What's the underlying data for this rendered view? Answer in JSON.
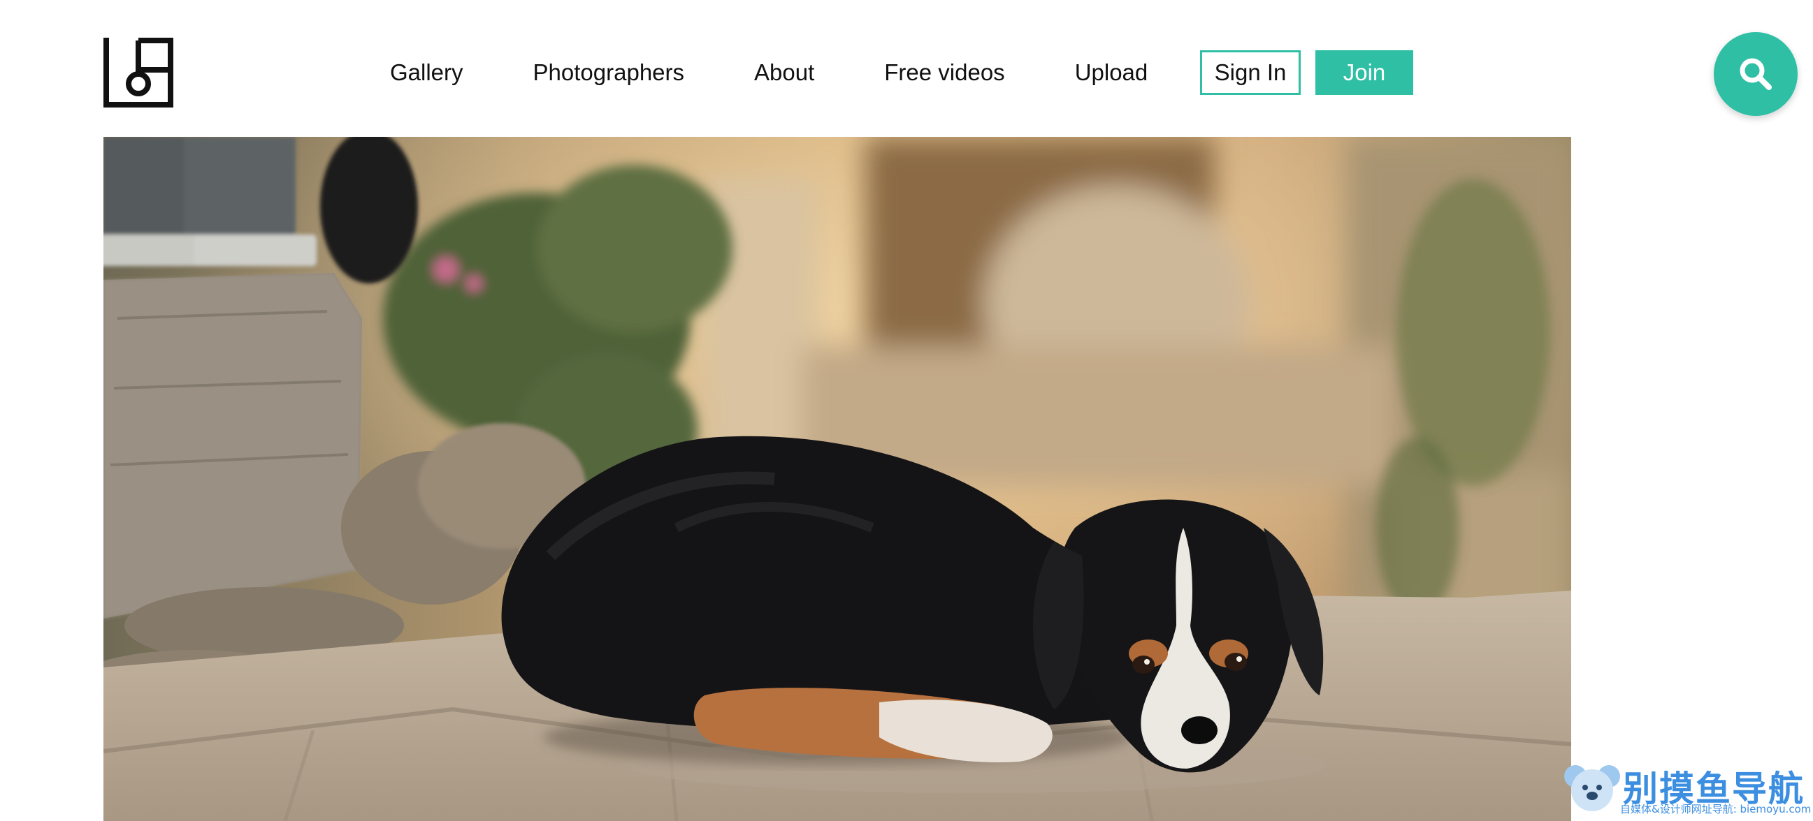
{
  "header": {
    "logo_icon": "camera-frame-logo-icon",
    "nav": [
      {
        "label": "Gallery"
      },
      {
        "label": "Photographers"
      },
      {
        "label": "About"
      },
      {
        "label": "Free videos"
      },
      {
        "label": "Upload"
      }
    ],
    "sign_in_label": "Sign In",
    "join_label": "Join",
    "search_icon": "search-icon"
  },
  "hero": {
    "subject": "dog lying on stone pavement"
  },
  "watermark": {
    "title": "别摸鱼导航",
    "subtitle": "自媒体&设计师网址导航: biemoyu.com"
  },
  "colors": {
    "accent": "#2ebfa5",
    "text": "#111111",
    "watermark": "#3b8ee0"
  }
}
